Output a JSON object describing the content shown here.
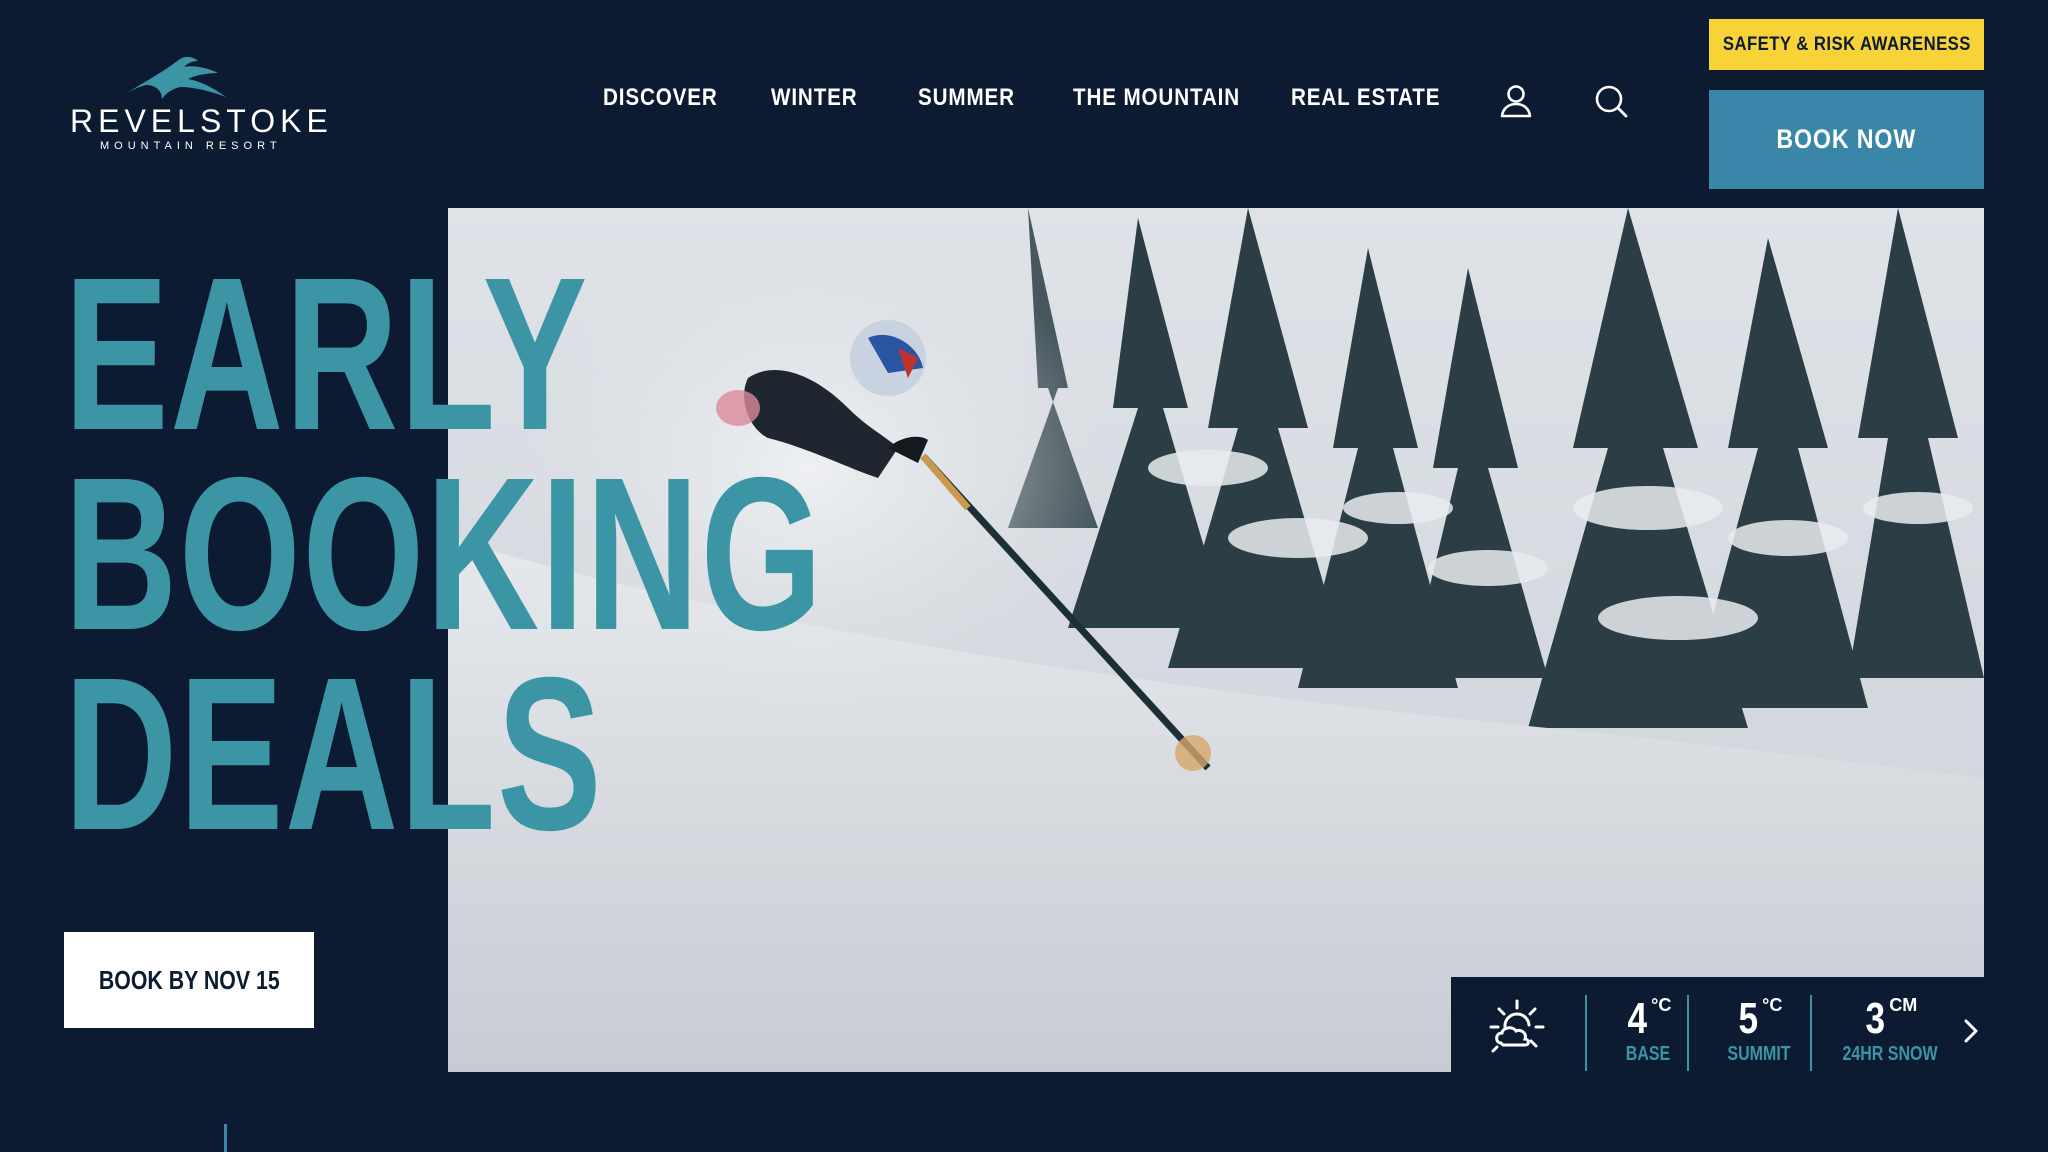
{
  "brand": {
    "name": "REVELSTOKE",
    "tagline": "MOUNTAIN RESORT",
    "logo_icon": "mountain-logo-icon"
  },
  "nav": {
    "items": [
      {
        "label": "DISCOVER"
      },
      {
        "label": "WINTER"
      },
      {
        "label": "SUMMER"
      },
      {
        "label": "THE MOUNTAIN"
      },
      {
        "label": "REAL ESTATE"
      }
    ],
    "account_icon": "user-icon",
    "search_icon": "search-icon"
  },
  "cta": {
    "safety_label": "SAFETY & RISK AWARENESS",
    "book_now_label": "BOOK NOW"
  },
  "hero": {
    "headline_lines": [
      "EARLY",
      "BOOKING",
      "DEALS"
    ],
    "book_by_label": "BOOK BY NOV 15",
    "image_subject": "skier in deep powder snow among snowy trees"
  },
  "weather": {
    "icon": "partly-sunny-icon",
    "stats": [
      {
        "value": "4",
        "unit": "°C",
        "label": "BASE"
      },
      {
        "value": "5",
        "unit": "°C",
        "label": "SUMMIT"
      },
      {
        "value": "3",
        "unit": "CM",
        "label": "24HR SNOW"
      }
    ],
    "next_icon": "chevron-right-icon"
  },
  "colors": {
    "background": "#0c1a32",
    "accent_teal": "#3b95a4",
    "book_now_blue": "#3a86a8",
    "safety_yellow": "#f7d338"
  }
}
